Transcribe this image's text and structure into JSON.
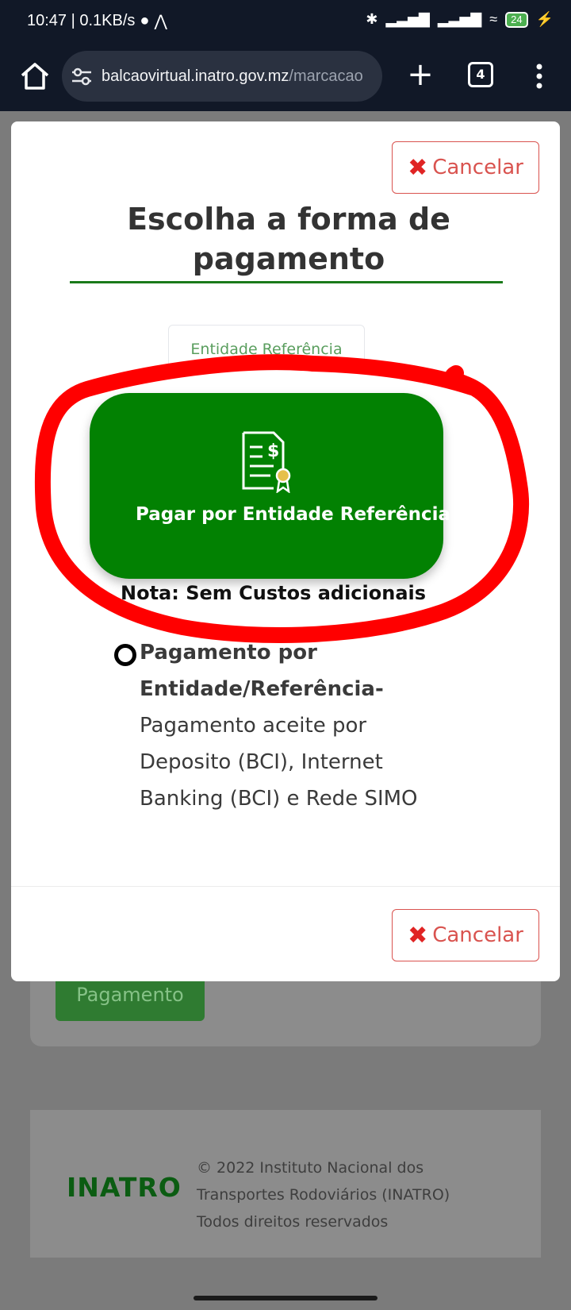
{
  "status_bar": {
    "time_speed": "10:47 | 0.1KB/s",
    "battery": "24"
  },
  "browser": {
    "url_host": "balcaovirtual.inatro.gov.mz",
    "url_path": "/marcacao",
    "tab_count": "4"
  },
  "background": {
    "pay_button": "Pagamento",
    "footer": {
      "logo": "INATRO",
      "line1": "© 2022 Instituto Nacional dos",
      "line2": "Transportes Rodoviários (INATRO)",
      "line3": "Todos direitos reservados"
    }
  },
  "modal": {
    "cancel_label": "Cancelar",
    "title_line1": "Escolha a forma de",
    "title_line2": "pagamento",
    "tab_label": "Entidade Referência",
    "card_label": "Pagar por Entidade Referência",
    "note": "Nota: Sem Custos adicionais",
    "option_bold_1": "Pagamento por",
    "option_bold_2": "Entidade/Referência-",
    "option_desc_1": "Pagamento aceite por",
    "option_desc_2": "Deposito (BCI), Internet",
    "option_desc_3": "Banking (BCI) e Rede SIMO"
  },
  "colors": {
    "brand_green": "#028102",
    "cancel_red": "#d9534f",
    "annotation_red": "#ff0000"
  }
}
